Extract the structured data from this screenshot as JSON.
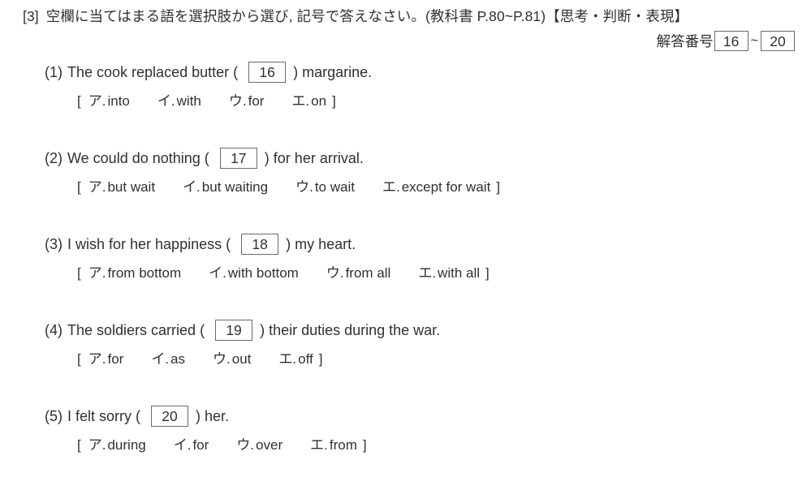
{
  "header": {
    "section_tag": "[3]",
    "instruction": "空欄に当てはまる語を選択肢から選び, 記号で答えなさい。(教科書 P.80~P.81)【思考・判断・表現】"
  },
  "answer_number": {
    "label": "解答番号",
    "start": "16",
    "separator": "~",
    "end": "20"
  },
  "questions": [
    {
      "number": "(1)",
      "text_before": "The cook replaced butter",
      "blank": "16",
      "text_after": "margarine.",
      "bracket_open": "[",
      "bracket_close": "]",
      "options": [
        {
          "marker": "ア.",
          "text": "into"
        },
        {
          "marker": "イ.",
          "text": "with"
        },
        {
          "marker": "ウ.",
          "text": "for"
        },
        {
          "marker": "エ.",
          "text": "on"
        }
      ]
    },
    {
      "number": "(2)",
      "text_before": "We could do nothing",
      "blank": "17",
      "text_after": "for her arrival.",
      "bracket_open": "[",
      "bracket_close": "]",
      "options": [
        {
          "marker": "ア.",
          "text": "but wait"
        },
        {
          "marker": "イ.",
          "text": "but waiting"
        },
        {
          "marker": "ウ.",
          "text": "to wait"
        },
        {
          "marker": "エ.",
          "text": "except for wait"
        }
      ]
    },
    {
      "number": "(3)",
      "text_before": "I wish for her happiness",
      "blank": "18",
      "text_after": "my heart.",
      "bracket_open": "[",
      "bracket_close": "]",
      "options": [
        {
          "marker": "ア.",
          "text": "from bottom"
        },
        {
          "marker": "イ.",
          "text": "with bottom"
        },
        {
          "marker": "ウ.",
          "text": "from all"
        },
        {
          "marker": "エ.",
          "text": "with all"
        }
      ]
    },
    {
      "number": "(4)",
      "text_before": "The soldiers carried",
      "blank": "19",
      "text_after": "their duties during the war.",
      "bracket_open": "[",
      "bracket_close": "]",
      "options": [
        {
          "marker": "ア.",
          "text": "for"
        },
        {
          "marker": "イ.",
          "text": "as"
        },
        {
          "marker": "ウ.",
          "text": "out"
        },
        {
          "marker": "エ.",
          "text": "off"
        }
      ]
    },
    {
      "number": "(5)",
      "text_before": "I felt sorry",
      "blank": "20",
      "text_after": "her.",
      "bracket_open": "[",
      "bracket_close": "]",
      "options": [
        {
          "marker": "ア.",
          "text": "during"
        },
        {
          "marker": "イ.",
          "text": "for"
        },
        {
          "marker": "ウ.",
          "text": "over"
        },
        {
          "marker": "エ.",
          "text": "from"
        }
      ]
    }
  ],
  "symbols": {
    "paren_open": "(",
    "paren_close": ")"
  },
  "colors": {
    "text": "#303030",
    "box_border": "#6a6a6a",
    "background": "#ffffff"
  }
}
